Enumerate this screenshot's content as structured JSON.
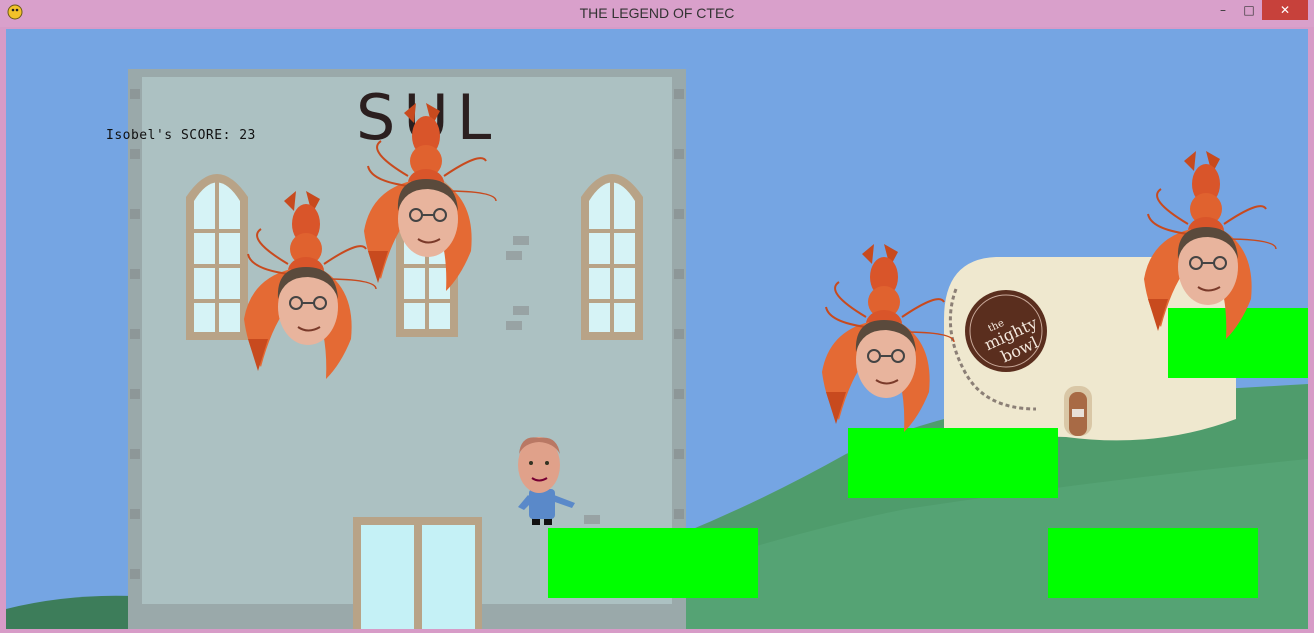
{
  "window": {
    "title": "THE LEGEND OF CTEC",
    "minimize_glyph": "–",
    "maximize_glyph": "□",
    "close_glyph": "✕"
  },
  "hud": {
    "score_text": "Isobel's SCORE: 23"
  },
  "scene": {
    "building_sign": "SUL",
    "cafe_logo_line1": "the",
    "cafe_logo_line2": "mighty",
    "cafe_logo_line3": "bowl"
  },
  "colors": {
    "sky": "#75a5e3",
    "platform": "#00ff00",
    "hill": "#4f9c6c",
    "building": "#acc1c2"
  },
  "sprites": {
    "player": "player-character",
    "enemy": "lobster-face-enemy",
    "enemy_count": 4,
    "platform_count": 4
  }
}
